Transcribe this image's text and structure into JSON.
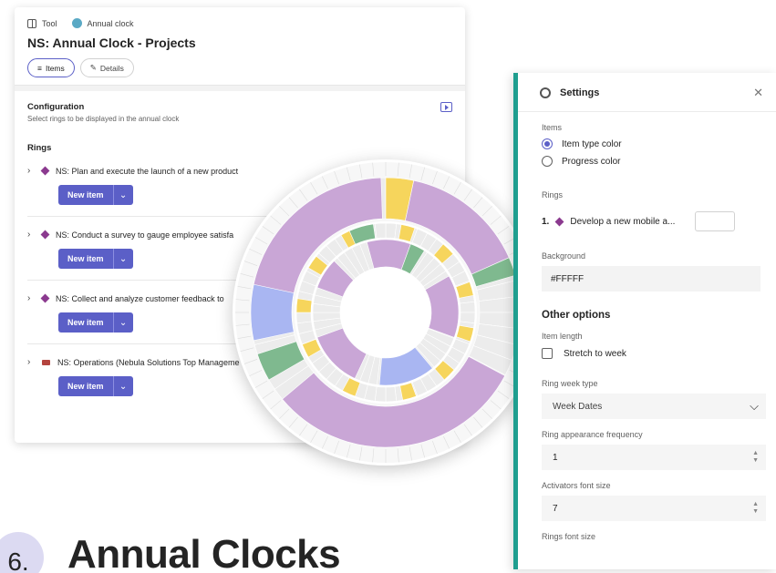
{
  "left_panel": {
    "breadcrumb": {
      "tool": "Tool",
      "clock": "Annual clock"
    },
    "title": "NS: Annual Clock - Projects",
    "tabs": [
      {
        "label": "Items"
      },
      {
        "label": "Details"
      }
    ],
    "configuration": {
      "title": "Configuration",
      "subtitle": "Select rings to be displayed in the annual clock",
      "rings_label": "Rings"
    },
    "rings": [
      {
        "name": "NS: Plan and execute the launch of a new product",
        "button": "New item"
      },
      {
        "name": "NS: Conduct a survey to gauge employee satisfa",
        "button": "New item"
      },
      {
        "name": "NS: Collect and analyze customer feedback to",
        "button": "New item"
      },
      {
        "name": "NS: Operations (Nebula Solutions Top Manageme",
        "button": "New item"
      }
    ]
  },
  "settings": {
    "title": "Settings",
    "items_label": "Items",
    "item_options": [
      {
        "label": "Item type color",
        "selected": true
      },
      {
        "label": "Progress color",
        "selected": false
      }
    ],
    "rings_label": "Rings",
    "ring_entry": {
      "index": "1.",
      "name": "Develop a new mobile a..."
    },
    "background_label": "Background",
    "background_value": "#FFFFF",
    "other_options": "Other options",
    "item_length_label": "Item length",
    "stretch_label": "Stretch to week",
    "ring_week_type_label": "Ring week type",
    "ring_week_type_value": "Week Dates",
    "ring_freq_label": "Ring appearance frequency",
    "ring_freq_value": "1",
    "activators_font_label": "Activators font size",
    "activators_font_value": "7",
    "rings_font_label": "Rings font size"
  },
  "footer": {
    "number": "6.",
    "title": "Annual Clocks"
  },
  "colors": {
    "accent": "#5b5fc7",
    "teal": "#1f9e8f",
    "clock_purple": "#c9a6d6",
    "clock_yellow": "#f6d55c",
    "clock_green": "#7fb98f",
    "clock_blue": "#a9b6f2"
  }
}
